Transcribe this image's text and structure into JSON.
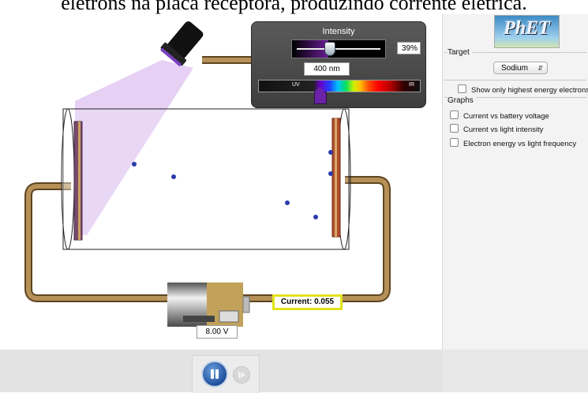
{
  "caption": "elétrons na placa receptora, produzindo corrente elétrica.",
  "intensity": {
    "title": "Intensity",
    "percent_label": "39%",
    "percent_value": 0.39,
    "wavelength_label": "400 nm",
    "wavelength_position": 0.38,
    "uv_label": "UV",
    "ir_label": "IR"
  },
  "battery": {
    "voltage_label": "8.00 V"
  },
  "ammeter": {
    "label": "Current:",
    "value": "0.055"
  },
  "colors": {
    "light_beam": "#d9b8f0",
    "wire": "#9b7a45",
    "electron": "#2a3cab",
    "emitter": "#7a4a6e",
    "collector": "#b04d2a",
    "highlight": "#e3e31b"
  },
  "panel": {
    "logo": "PhET",
    "target_section": "Target",
    "target_value": "Sodium",
    "show_highest_label": "Show only highest energy electrons",
    "graphs_section": "Graphs",
    "graph_options": [
      "Current vs battery voltage",
      "Current vs light intensity",
      "Electron energy vs light frequency"
    ]
  },
  "controls": {
    "play_state": "pause-icon",
    "step_icon": "step-icon"
  }
}
